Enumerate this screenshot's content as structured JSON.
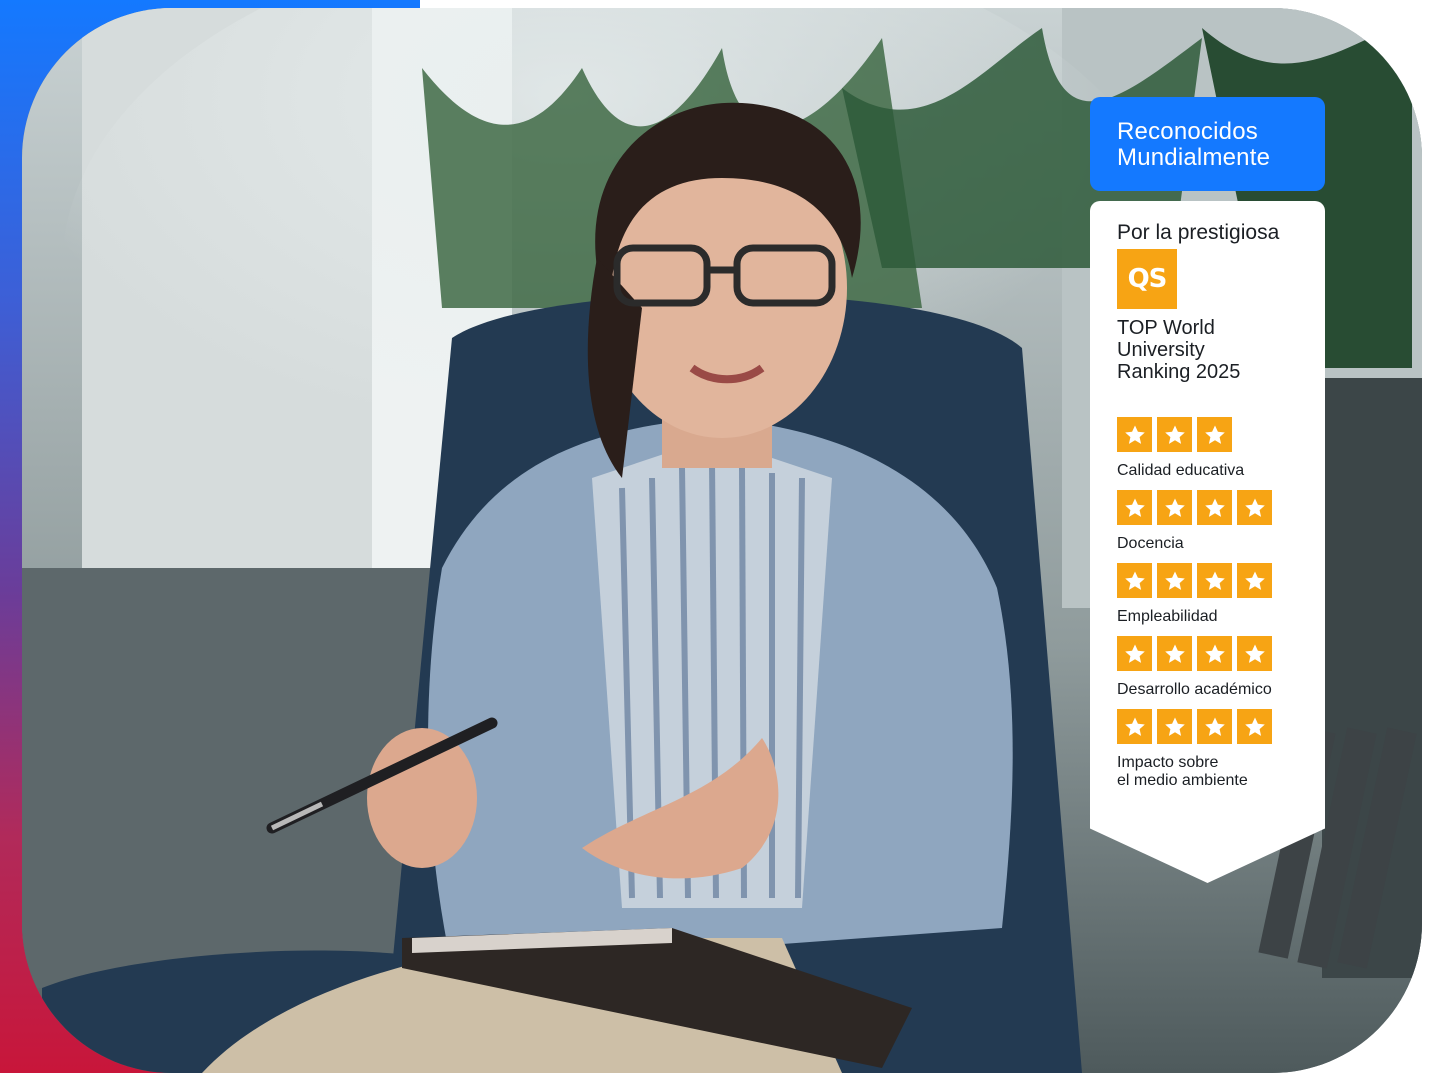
{
  "badge": {
    "header_line1": "Reconocidos",
    "header_line2": "Mundialmente",
    "intro": "Por la prestigiosa",
    "logo_text": "QS",
    "ranking_line1": "TOP World",
    "ranking_line2": "University",
    "ranking_line3": "Ranking 2025",
    "criteria": [
      {
        "stars": 3,
        "label_line1": "Calidad educativa",
        "label_line2": ""
      },
      {
        "stars": 4,
        "label_line1": "Docencia",
        "label_line2": ""
      },
      {
        "stars": 4,
        "label_line1": "Empleabilidad",
        "label_line2": ""
      },
      {
        "stars": 4,
        "label_line1": "Desarrollo académico",
        "label_line2": ""
      },
      {
        "stars": 4,
        "label_line1": "Impacto sobre",
        "label_line2": "el medio ambiente"
      }
    ]
  },
  "colors": {
    "brand_blue": "#1479ff",
    "star_orange": "#f7a414",
    "accent_red": "#c8163a"
  },
  "icons": {
    "logo": "qs-logo",
    "rating": "star-icon"
  }
}
